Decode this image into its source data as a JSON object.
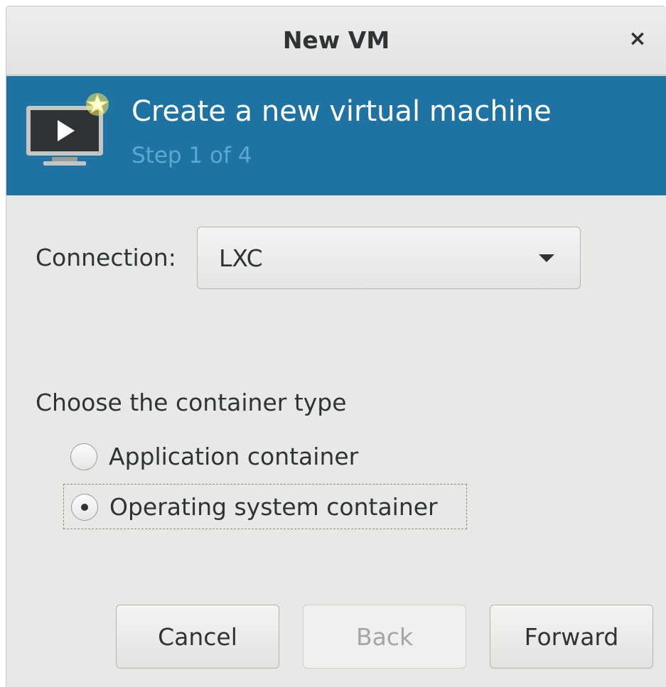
{
  "window": {
    "title": "New VM",
    "close_glyph": "×"
  },
  "banner": {
    "title": "Create a new virtual machine",
    "step": "Step 1 of 4",
    "icon": "monitor-play-star-icon",
    "bg_color": "#1e73a2"
  },
  "connection": {
    "label": "Connection:",
    "value": "LXC"
  },
  "container_type": {
    "label": "Choose the container type",
    "options": [
      {
        "label": "Application container",
        "selected": false
      },
      {
        "label": "Operating system container",
        "selected": true
      }
    ]
  },
  "buttons": {
    "cancel": "Cancel",
    "back": "Back",
    "forward": "Forward"
  }
}
